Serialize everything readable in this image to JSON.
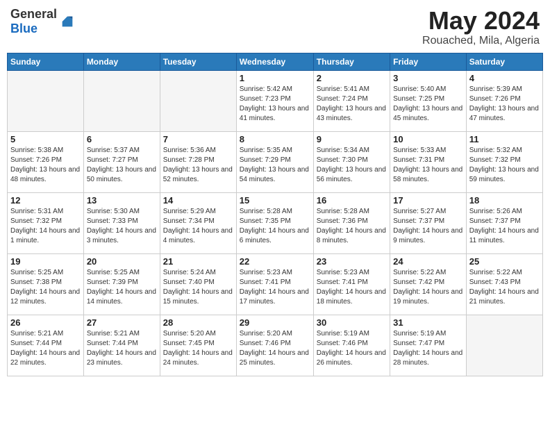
{
  "header": {
    "logo_general": "General",
    "logo_blue": "Blue",
    "month": "May 2024",
    "location": "Rouached, Mila, Algeria"
  },
  "weekdays": [
    "Sunday",
    "Monday",
    "Tuesday",
    "Wednesday",
    "Thursday",
    "Friday",
    "Saturday"
  ],
  "weeks": [
    [
      {
        "day": "",
        "sunrise": "",
        "sunset": "",
        "daylight": ""
      },
      {
        "day": "",
        "sunrise": "",
        "sunset": "",
        "daylight": ""
      },
      {
        "day": "",
        "sunrise": "",
        "sunset": "",
        "daylight": ""
      },
      {
        "day": "1",
        "sunrise": "Sunrise: 5:42 AM",
        "sunset": "Sunset: 7:23 PM",
        "daylight": "Daylight: 13 hours and 41 minutes."
      },
      {
        "day": "2",
        "sunrise": "Sunrise: 5:41 AM",
        "sunset": "Sunset: 7:24 PM",
        "daylight": "Daylight: 13 hours and 43 minutes."
      },
      {
        "day": "3",
        "sunrise": "Sunrise: 5:40 AM",
        "sunset": "Sunset: 7:25 PM",
        "daylight": "Daylight: 13 hours and 45 minutes."
      },
      {
        "day": "4",
        "sunrise": "Sunrise: 5:39 AM",
        "sunset": "Sunset: 7:26 PM",
        "daylight": "Daylight: 13 hours and 47 minutes."
      }
    ],
    [
      {
        "day": "5",
        "sunrise": "Sunrise: 5:38 AM",
        "sunset": "Sunset: 7:26 PM",
        "daylight": "Daylight: 13 hours and 48 minutes."
      },
      {
        "day": "6",
        "sunrise": "Sunrise: 5:37 AM",
        "sunset": "Sunset: 7:27 PM",
        "daylight": "Daylight: 13 hours and 50 minutes."
      },
      {
        "day": "7",
        "sunrise": "Sunrise: 5:36 AM",
        "sunset": "Sunset: 7:28 PM",
        "daylight": "Daylight: 13 hours and 52 minutes."
      },
      {
        "day": "8",
        "sunrise": "Sunrise: 5:35 AM",
        "sunset": "Sunset: 7:29 PM",
        "daylight": "Daylight: 13 hours and 54 minutes."
      },
      {
        "day": "9",
        "sunrise": "Sunrise: 5:34 AM",
        "sunset": "Sunset: 7:30 PM",
        "daylight": "Daylight: 13 hours and 56 minutes."
      },
      {
        "day": "10",
        "sunrise": "Sunrise: 5:33 AM",
        "sunset": "Sunset: 7:31 PM",
        "daylight": "Daylight: 13 hours and 58 minutes."
      },
      {
        "day": "11",
        "sunrise": "Sunrise: 5:32 AM",
        "sunset": "Sunset: 7:32 PM",
        "daylight": "Daylight: 13 hours and 59 minutes."
      }
    ],
    [
      {
        "day": "12",
        "sunrise": "Sunrise: 5:31 AM",
        "sunset": "Sunset: 7:32 PM",
        "daylight": "Daylight: 14 hours and 1 minute."
      },
      {
        "day": "13",
        "sunrise": "Sunrise: 5:30 AM",
        "sunset": "Sunset: 7:33 PM",
        "daylight": "Daylight: 14 hours and 3 minutes."
      },
      {
        "day": "14",
        "sunrise": "Sunrise: 5:29 AM",
        "sunset": "Sunset: 7:34 PM",
        "daylight": "Daylight: 14 hours and 4 minutes."
      },
      {
        "day": "15",
        "sunrise": "Sunrise: 5:28 AM",
        "sunset": "Sunset: 7:35 PM",
        "daylight": "Daylight: 14 hours and 6 minutes."
      },
      {
        "day": "16",
        "sunrise": "Sunrise: 5:28 AM",
        "sunset": "Sunset: 7:36 PM",
        "daylight": "Daylight: 14 hours and 8 minutes."
      },
      {
        "day": "17",
        "sunrise": "Sunrise: 5:27 AM",
        "sunset": "Sunset: 7:37 PM",
        "daylight": "Daylight: 14 hours and 9 minutes."
      },
      {
        "day": "18",
        "sunrise": "Sunrise: 5:26 AM",
        "sunset": "Sunset: 7:37 PM",
        "daylight": "Daylight: 14 hours and 11 minutes."
      }
    ],
    [
      {
        "day": "19",
        "sunrise": "Sunrise: 5:25 AM",
        "sunset": "Sunset: 7:38 PM",
        "daylight": "Daylight: 14 hours and 12 minutes."
      },
      {
        "day": "20",
        "sunrise": "Sunrise: 5:25 AM",
        "sunset": "Sunset: 7:39 PM",
        "daylight": "Daylight: 14 hours and 14 minutes."
      },
      {
        "day": "21",
        "sunrise": "Sunrise: 5:24 AM",
        "sunset": "Sunset: 7:40 PM",
        "daylight": "Daylight: 14 hours and 15 minutes."
      },
      {
        "day": "22",
        "sunrise": "Sunrise: 5:23 AM",
        "sunset": "Sunset: 7:41 PM",
        "daylight": "Daylight: 14 hours and 17 minutes."
      },
      {
        "day": "23",
        "sunrise": "Sunrise: 5:23 AM",
        "sunset": "Sunset: 7:41 PM",
        "daylight": "Daylight: 14 hours and 18 minutes."
      },
      {
        "day": "24",
        "sunrise": "Sunrise: 5:22 AM",
        "sunset": "Sunset: 7:42 PM",
        "daylight": "Daylight: 14 hours and 19 minutes."
      },
      {
        "day": "25",
        "sunrise": "Sunrise: 5:22 AM",
        "sunset": "Sunset: 7:43 PM",
        "daylight": "Daylight: 14 hours and 21 minutes."
      }
    ],
    [
      {
        "day": "26",
        "sunrise": "Sunrise: 5:21 AM",
        "sunset": "Sunset: 7:44 PM",
        "daylight": "Daylight: 14 hours and 22 minutes."
      },
      {
        "day": "27",
        "sunrise": "Sunrise: 5:21 AM",
        "sunset": "Sunset: 7:44 PM",
        "daylight": "Daylight: 14 hours and 23 minutes."
      },
      {
        "day": "28",
        "sunrise": "Sunrise: 5:20 AM",
        "sunset": "Sunset: 7:45 PM",
        "daylight": "Daylight: 14 hours and 24 minutes."
      },
      {
        "day": "29",
        "sunrise": "Sunrise: 5:20 AM",
        "sunset": "Sunset: 7:46 PM",
        "daylight": "Daylight: 14 hours and 25 minutes."
      },
      {
        "day": "30",
        "sunrise": "Sunrise: 5:19 AM",
        "sunset": "Sunset: 7:46 PM",
        "daylight": "Daylight: 14 hours and 26 minutes."
      },
      {
        "day": "31",
        "sunrise": "Sunrise: 5:19 AM",
        "sunset": "Sunset: 7:47 PM",
        "daylight": "Daylight: 14 hours and 28 minutes."
      },
      {
        "day": "",
        "sunrise": "",
        "sunset": "",
        "daylight": ""
      }
    ]
  ]
}
